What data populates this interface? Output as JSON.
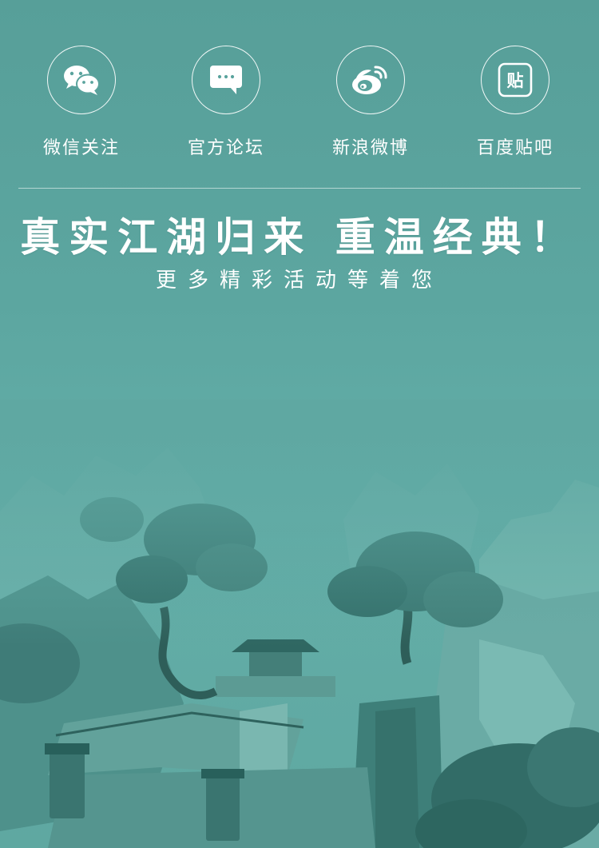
{
  "social": [
    {
      "label": "微信关注",
      "icon": "wechat-icon"
    },
    {
      "label": "官方论坛",
      "icon": "forum-chat-icon"
    },
    {
      "label": "新浪微博",
      "icon": "weibo-icon"
    },
    {
      "label": "百度贴吧",
      "icon": "tieba-icon",
      "icon_text": "贴"
    }
  ],
  "headline": "真实江湖归来 重温经典！",
  "subline": "更多精彩活动等着您",
  "colors": {
    "background": "#5aa39d",
    "text": "#ffffff",
    "scene_dark": "#2f6d68"
  }
}
